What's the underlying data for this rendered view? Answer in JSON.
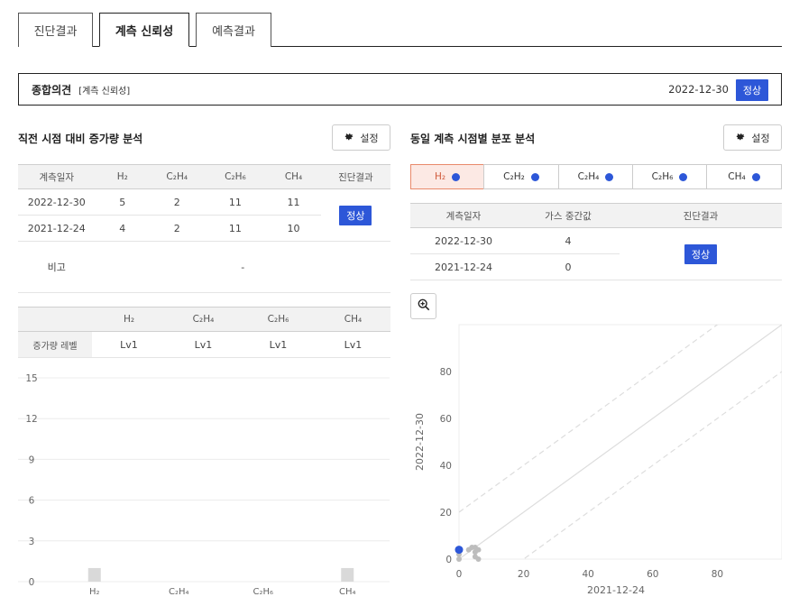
{
  "tabs": [
    {
      "label": "진단결과"
    },
    {
      "label": "계측 신뢰성"
    },
    {
      "label": "예측결과"
    }
  ],
  "summary": {
    "title": "종합의견",
    "subtitle": "[계측 신뢰성]",
    "date": "2022-12-30",
    "status": "정상"
  },
  "left": {
    "title": "직전 시점 대비 증가량 분석",
    "settings_label": "설정",
    "table1": {
      "headers": [
        "계측일자",
        "H₂",
        "C₂H₄",
        "C₂H₆",
        "CH₄",
        "진단결과"
      ],
      "rows": [
        [
          "2022-12-30",
          "5",
          "2",
          "11",
          "11"
        ],
        [
          "2021-12-24",
          "4",
          "2",
          "11",
          "10"
        ]
      ],
      "result": "정상",
      "remark_label": "비고",
      "remark_value": "-"
    },
    "table2": {
      "headers": [
        "H₂",
        "C₂H₄",
        "C₂H₆",
        "CH₄"
      ],
      "row_label": "증가량 레벨",
      "values": [
        "Lv1",
        "Lv1",
        "Lv1",
        "Lv1"
      ]
    }
  },
  "right": {
    "title": "동일 계측 시점별 분포 분석",
    "settings_label": "설정",
    "gas_buttons": [
      {
        "label": "H₂",
        "active": true
      },
      {
        "label": "C₂H₂",
        "active": false
      },
      {
        "label": "C₂H₄",
        "active": false
      },
      {
        "label": "C₂H₆",
        "active": false
      },
      {
        "label": "CH₄",
        "active": false
      }
    ],
    "table": {
      "headers": [
        "계측일자",
        "가스 중간값",
        "진단결과"
      ],
      "rows": [
        [
          "2022-12-30",
          "4"
        ],
        [
          "2021-12-24",
          "0"
        ]
      ],
      "result": "정상"
    }
  },
  "chart_data": [
    {
      "type": "bar",
      "categories": [
        "H₂",
        "C₂H₄",
        "C₂H₆",
        "CH₄"
      ],
      "values": [
        1,
        0,
        0,
        1
      ],
      "ylim": [
        0,
        15
      ],
      "yticks": [
        0,
        3,
        6,
        9,
        12,
        15
      ],
      "grid": true,
      "bar_color": "#d9d9d9"
    },
    {
      "type": "scatter",
      "xlabel": "2021-12-24",
      "ylabel": "2022-12-30",
      "xlim": [
        0,
        100
      ],
      "ylim": [
        0,
        100
      ],
      "xticks": [
        0,
        20,
        40,
        60,
        80
      ],
      "yticks": [
        0,
        20,
        40,
        60,
        80
      ],
      "highlight_point": {
        "x": 0,
        "y": 4,
        "color": "#2d57d8"
      },
      "points": [
        {
          "x": 0,
          "y": 0
        },
        {
          "x": 0,
          "y": 2
        },
        {
          "x": 3,
          "y": 4
        },
        {
          "x": 4,
          "y": 5
        },
        {
          "x": 5,
          "y": 3
        },
        {
          "x": 5,
          "y": 1
        },
        {
          "x": 5,
          "y": 5
        },
        {
          "x": 6,
          "y": 4
        },
        {
          "x": 6,
          "y": 0
        }
      ],
      "reference_lines": [
        {
          "kind": "solid",
          "offset": 0
        },
        {
          "kind": "dashed",
          "offset": 20
        },
        {
          "kind": "dashed",
          "offset": -20
        }
      ]
    }
  ]
}
